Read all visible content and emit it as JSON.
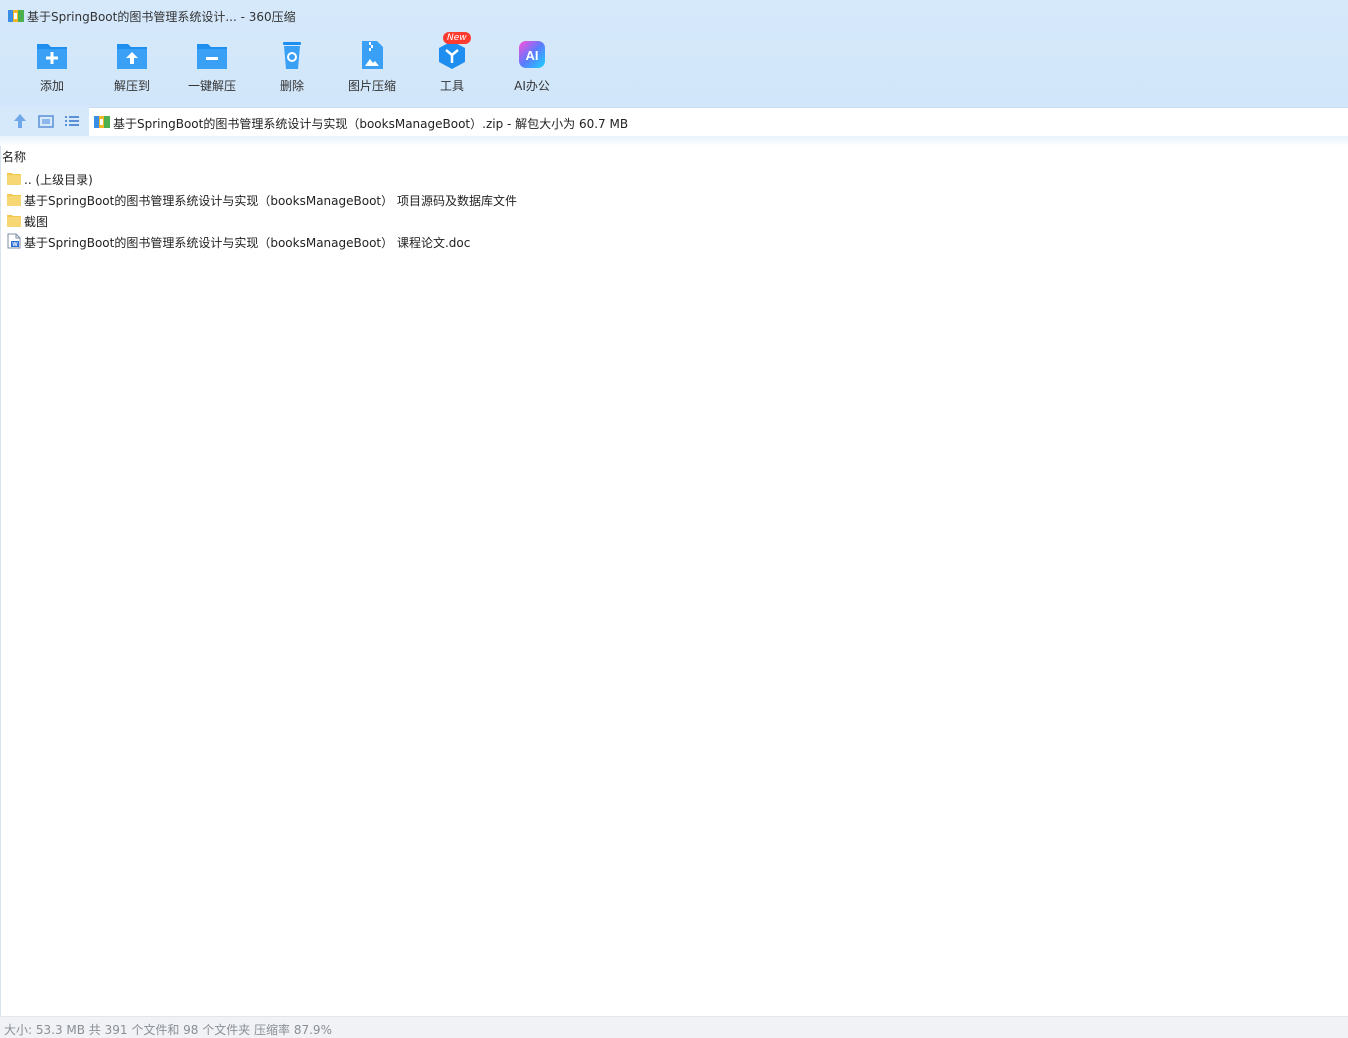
{
  "window": {
    "title": "基于SpringBoot的图书管理系统设计... - 360压缩"
  },
  "toolbar": {
    "items": [
      {
        "label": "添加",
        "icon": "add-folder-icon"
      },
      {
        "label": "解压到",
        "icon": "extract-to-icon"
      },
      {
        "label": "一键解压",
        "icon": "one-click-extract-icon"
      },
      {
        "label": "删除",
        "icon": "delete-icon"
      },
      {
        "label": "图片压缩",
        "icon": "image-compress-icon"
      },
      {
        "label": "工具",
        "icon": "tools-icon",
        "badge": "New"
      },
      {
        "label": "AI办公",
        "icon": "ai-office-icon"
      }
    ]
  },
  "address": {
    "path": "基于SpringBoot的图书管理系统设计与实现（booksManageBoot）.zip - 解包大小为 60.7 MB"
  },
  "list": {
    "column_name": "名称",
    "rows": [
      {
        "name": ".. (上级目录)",
        "type": "folder"
      },
      {
        "name": "基于SpringBoot的图书管理系统设计与实现（booksManageBoot） 项目源码及数据库文件",
        "type": "folder"
      },
      {
        "name": "截图",
        "type": "folder"
      },
      {
        "name": "基于SpringBoot的图书管理系统设计与实现（booksManageBoot） 课程论文.doc",
        "type": "doc"
      }
    ]
  },
  "status": {
    "text": "大小: 53.3 MB 共 391 个文件和 98 个文件夹 压缩率 87.9%"
  },
  "colors": {
    "accent": "#1e8ff0",
    "toolbar_bg": "#d6e9fb",
    "folder": "#f7d774",
    "badge": "#ff3b30"
  }
}
